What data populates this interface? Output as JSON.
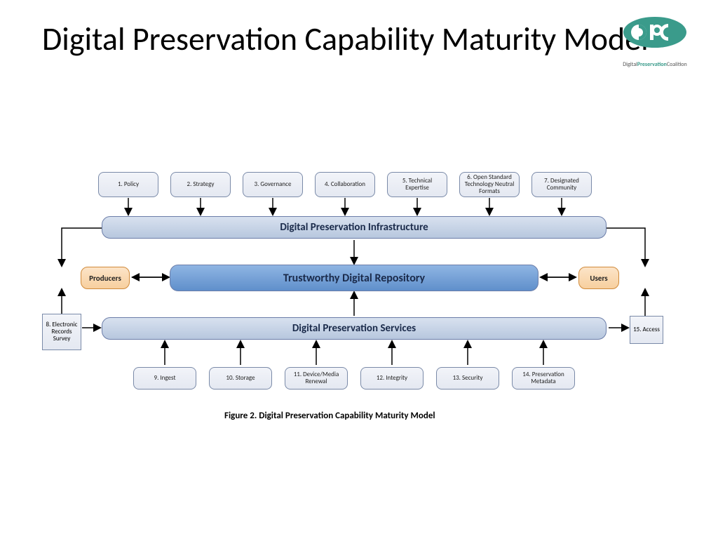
{
  "title": "Digital Preservation Capability Maturity Model",
  "logo": {
    "text_pre": "Digital",
    "text_bold": "Preservation",
    "text_post": "Coalition"
  },
  "top_boxes": [
    "1. Policy",
    "2. Strategy",
    "3. Governance",
    "4. Collaboration",
    "5. Technical Expertise",
    "6. Open Standard Technology Neutral Formats",
    "7. Designated Community"
  ],
  "bars": {
    "infrastructure": "Digital Preservation Infrastructure",
    "repository": "Trustworthy Digital Repository",
    "services": "Digital Preservation Services"
  },
  "endpoints": {
    "producers": "Producers",
    "users": "Users"
  },
  "side_boxes": {
    "survey": "8. Electronic Records Survey",
    "access": "15. Access"
  },
  "bottom_boxes": [
    "9. Ingest",
    "10. Storage",
    "11. Device/Media Renewal",
    "12. Integrity",
    "13. Security",
    "14. Preservation Metadata"
  ],
  "caption": "Figure 2. Digital Preservation Capability Maturity Model"
}
